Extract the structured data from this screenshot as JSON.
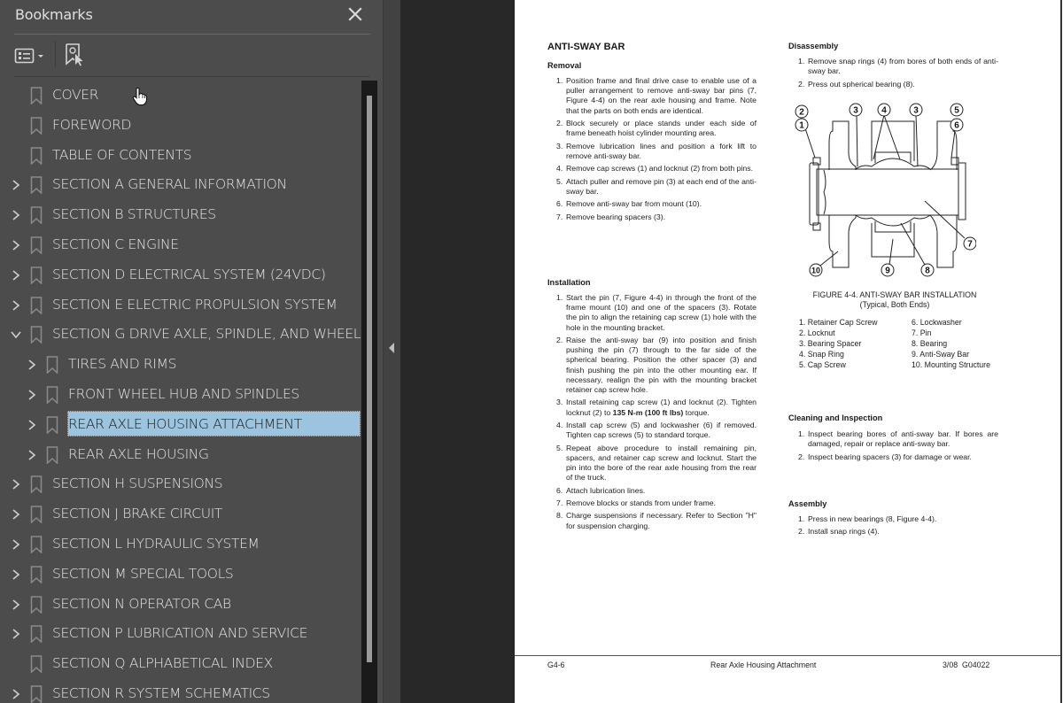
{
  "bookmarks_panel": {
    "title": "Bookmarks",
    "close_icon": "close-icon",
    "toolbar": {
      "options_icon": "list-options-icon",
      "find_icon": "find-current-bookmark-icon"
    },
    "items": [
      {
        "label": "COVER",
        "level": 0,
        "expandable": false,
        "expanded": false,
        "selected": false
      },
      {
        "label": "FOREWORD",
        "level": 0,
        "expandable": false,
        "expanded": false,
        "selected": false
      },
      {
        "label": "TABLE OF CONTENTS",
        "level": 0,
        "expandable": false,
        "expanded": false,
        "selected": false
      },
      {
        "label": "SECTION A GENERAL INFORMATION",
        "level": 0,
        "expandable": true,
        "expanded": false,
        "selected": false
      },
      {
        "label": "SECTION B STRUCTURES",
        "level": 0,
        "expandable": true,
        "expanded": false,
        "selected": false
      },
      {
        "label": "SECTION C ENGINE",
        "level": 0,
        "expandable": true,
        "expanded": false,
        "selected": false
      },
      {
        "label": "SECTION D ELECTRICAL SYSTEM (24VDC)",
        "level": 0,
        "expandable": true,
        "expanded": false,
        "selected": false
      },
      {
        "label": "SECTION E ELECTRIC PROPULSION SYSTEM",
        "level": 0,
        "expandable": true,
        "expanded": false,
        "selected": false
      },
      {
        "label": "SECTION G DRIVE AXLE, SPINDLE, AND WHEELS",
        "level": 0,
        "expandable": true,
        "expanded": true,
        "selected": false
      },
      {
        "label": "TIRES AND RIMS",
        "level": 1,
        "expandable": true,
        "expanded": false,
        "selected": false
      },
      {
        "label": "FRONT WHEEL HUB AND SPINDLES",
        "level": 1,
        "expandable": true,
        "expanded": false,
        "selected": false
      },
      {
        "label": "REAR AXLE HOUSING ATTACHMENT",
        "level": 1,
        "expandable": true,
        "expanded": false,
        "selected": true
      },
      {
        "label": "REAR AXLE HOUSING",
        "level": 1,
        "expandable": true,
        "expanded": false,
        "selected": false
      },
      {
        "label": "SECTION H SUSPENSIONS",
        "level": 0,
        "expandable": true,
        "expanded": false,
        "selected": false
      },
      {
        "label": "SECTION J BRAKE CIRCUIT",
        "level": 0,
        "expandable": true,
        "expanded": false,
        "selected": false
      },
      {
        "label": "SECTION L  HYDRAULIC SYSTEM",
        "level": 0,
        "expandable": true,
        "expanded": false,
        "selected": false
      },
      {
        "label": "SECTION M SPECIAL TOOLS",
        "level": 0,
        "expandable": true,
        "expanded": false,
        "selected": false
      },
      {
        "label": "SECTION N OPERATOR CAB",
        "level": 0,
        "expandable": true,
        "expanded": false,
        "selected": false
      },
      {
        "label": "SECTION P LUBRICATION AND SERVICE",
        "level": 0,
        "expandable": true,
        "expanded": false,
        "selected": false
      },
      {
        "label": "SECTION Q ALPHABETICAL INDEX",
        "level": 0,
        "expandable": false,
        "expanded": false,
        "selected": false
      },
      {
        "label": "SECTION R SYSTEM SCHEMATICS",
        "level": 0,
        "expandable": true,
        "expanded": false,
        "selected": false
      }
    ],
    "colors": {
      "panel_bg": "#4c4c4c",
      "selection_bg": "#9dc4df",
      "text": "#e4e4e4"
    }
  },
  "document": {
    "title": "ANTI-SWAY BAR",
    "removal": {
      "heading": "Removal",
      "steps": [
        "Position frame and final drive case to enable use of a puller arrangement to remove anti-sway bar pins (7, Figure 4-4) on the rear axle housing and frame. Note that the parts on both ends are identical.",
        "Block securely or place stands under each side of frame beneath hoist cylinder mounting area.",
        "Remove lubrication lines and position a fork lift to remove anti-sway bar.",
        "Remove cap screws (1) and locknut (2) from both pins.",
        "Attach puller and remove pin (3) at each end of the anti-sway bar.",
        "Remove anti-sway bar from mount (10).",
        "Remove bearing spacers (3)."
      ]
    },
    "installation": {
      "heading": "Installation",
      "steps": [
        "Start the pin (7, Figure 4-4) in through the front of the frame mount (10) and one of the spacers (3). Rotate the pin to align the retaining cap screw (1) hole with the hole in the mounting bracket.",
        "Raise the anti-sway bar (9) into position and finish pushing the pin (7) through to the far side of the spherical bearing. Position the other spacer (3) and finish pushing the pin into the other mounting ear. If necessary, realign the pin with the mounting bracket retainer cap screw hole.",
        "Install retaining cap screw (1) and locknut (2). Tighten locknut (2) to 135 N-m (100 ft lbs) torque.",
        "Install cap screw (5) and lockwasher (6) if removed. Tighten cap screws (5) to standard torque.",
        "Repeat above procedure to install remaining pin, spacers, and retainer cap screw and locknut. Start the pin into the bore of the rear axle housing from the rear of the truck.",
        "Attach lubrication lines.",
        "Remove blocks or stands from under frame.",
        "Charge suspensions if necessary. Refer to Section \"H\" for suspension charging."
      ]
    },
    "disassembly": {
      "heading": "Disassembly",
      "steps": [
        "Remove snap rings (4) from bores of both ends of anti-sway bar.",
        "Press out spherical bearing (8)."
      ]
    },
    "figure": {
      "callouts": [
        "2",
        "1",
        "3",
        "4",
        "3",
        "5",
        "6",
        "7",
        "10",
        "9",
        "8"
      ],
      "caption_line1": "FIGURE 4-4. ANTI-SWAY BAR INSTALLATION",
      "caption_line2": "(Typical, Both Ends)",
      "legend_left": [
        "1. Retainer Cap Screw",
        "2. Locknut",
        "3. Bearing Spacer",
        "4. Snap Ring",
        "5. Cap Screw"
      ],
      "legend_right": [
        "6. Lockwasher",
        "7. Pin",
        "8. Bearing",
        "9. Anti-Sway Bar",
        "10. Mounting Structure"
      ]
    },
    "cleaning": {
      "heading": "Cleaning and Inspection",
      "steps": [
        "Inspect bearing bores of anti-sway bar. If bores are damaged, repair or replace anti-sway bar.",
        "Inspect bearing spacers (3) for damage or wear."
      ]
    },
    "assembly": {
      "heading": "Assembly",
      "steps": [
        "Press in new bearings (8, Figure 4-4).",
        "Install snap rings (4)."
      ]
    },
    "footer": {
      "page": "G4-6",
      "title": "Rear Axle Housing Attachment",
      "date_code": "3/08  G04022"
    }
  }
}
